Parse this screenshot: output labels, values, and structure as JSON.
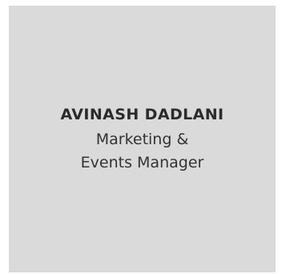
{
  "profile_card": {
    "name": "AVINASH DADLANI",
    "title_line1": "Marketing &",
    "title_line2": "Events Manager"
  },
  "colors": {
    "card_background": "#dadada",
    "text": "#2b2b2b"
  }
}
